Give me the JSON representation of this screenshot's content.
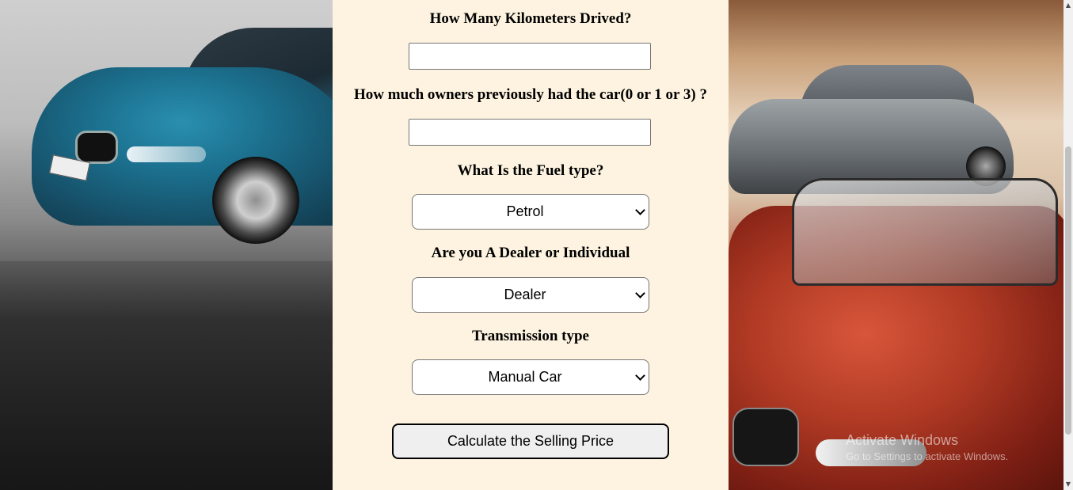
{
  "form": {
    "km_label": "How Many Kilometers Drived?",
    "km_value": "",
    "owners_label": "How much owners previously had the car(0 or 1 or 3) ?",
    "owners_value": "",
    "fuel_label": "What Is the Fuel type?",
    "fuel_selected": "Petrol",
    "seller_label": "Are you A Dealer or Individual",
    "seller_selected": "Dealer",
    "transmission_label": "Transmission type",
    "transmission_selected": "Manual Car",
    "submit_label": "Calculate the Selling Price"
  },
  "watermark": {
    "title": "Activate Windows",
    "subtitle": "Go to Settings to activate Windows."
  },
  "colors": {
    "panel_bg": "#fdf3e0",
    "button_bg": "#efefef"
  },
  "icons": {
    "select_arrow": "chevron-down-icon",
    "scroll_up": "scroll-up-arrow-icon",
    "scroll_down": "scroll-down-arrow-icon"
  }
}
